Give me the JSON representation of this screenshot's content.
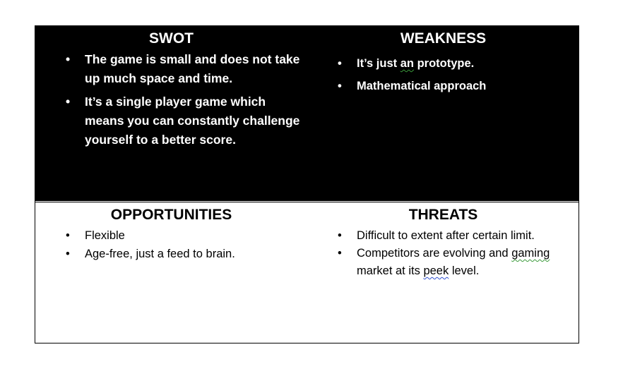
{
  "strengths": {
    "title": "SWOT",
    "items": [
      "The game is small and does not take up much space and time.",
      "It’s a single player game which means you can constantly challenge yourself to a better score."
    ]
  },
  "weakness": {
    "title": "WEAKNESS",
    "items": [
      {
        "pre": "It’s just ",
        "flag": "an",
        "post": " prototype."
      },
      "Mathematical approach"
    ]
  },
  "opportunities": {
    "title": "OPPORTUNITIES",
    "items": [
      "Flexible",
      "Age-free, just a feed to brain."
    ]
  },
  "threats": {
    "title": "THREATS",
    "items": [
      "Difficult to extent after certain limit.",
      {
        "pre": "Competitors are evolving and ",
        "flag1": "gaming",
        "mid": " market at its ",
        "flag2": "peek",
        "post": " level."
      }
    ]
  }
}
